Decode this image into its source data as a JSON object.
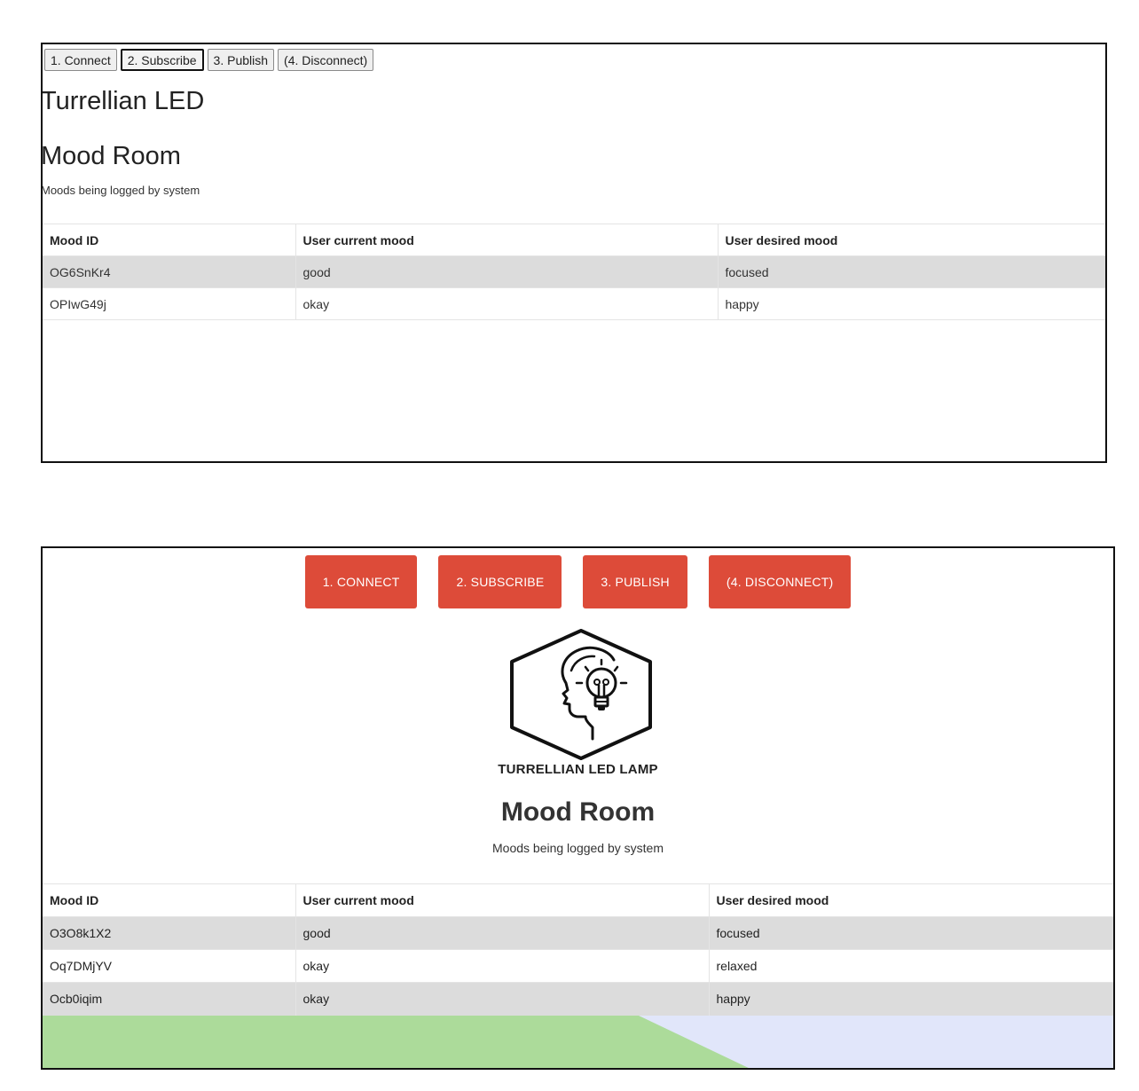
{
  "panel1": {
    "buttons": [
      "1. Connect",
      "2. Subscribe",
      "3. Publish",
      "(4. Disconnect)"
    ],
    "title": "Turrellian LED",
    "heading": "Mood Room",
    "subtitle": "Moods being logged by system",
    "table": {
      "headers": [
        "Mood ID",
        "User current mood",
        "User desired mood"
      ],
      "rows": [
        [
          "OG6SnKr4",
          "good",
          "focused"
        ],
        [
          "OPIwG49j",
          "okay",
          "happy"
        ]
      ]
    }
  },
  "panel2": {
    "buttons": [
      "1. CONNECT",
      "2. SUBSCRIBE",
      "3. PUBLISH",
      "(4. DISCONNECT)"
    ],
    "logo_icon": "head-lightbulb-hexagon-icon",
    "logo_text": "TURRELLIAN LED LAMP",
    "heading": "Mood Room",
    "subtitle": "Moods being logged by system",
    "table": {
      "headers": [
        "Mood ID",
        "User current mood",
        "User desired mood"
      ],
      "rows": [
        [
          "O3O8k1X2",
          "good",
          "focused"
        ],
        [
          "Oq7DMjYV",
          "okay",
          "relaxed"
        ],
        [
          "Ocb0iqim",
          "okay",
          "happy"
        ]
      ]
    },
    "colors": {
      "button": "#dd4b39",
      "background_green": "#acdb9a",
      "background_blue": "#e1e6fa"
    }
  }
}
